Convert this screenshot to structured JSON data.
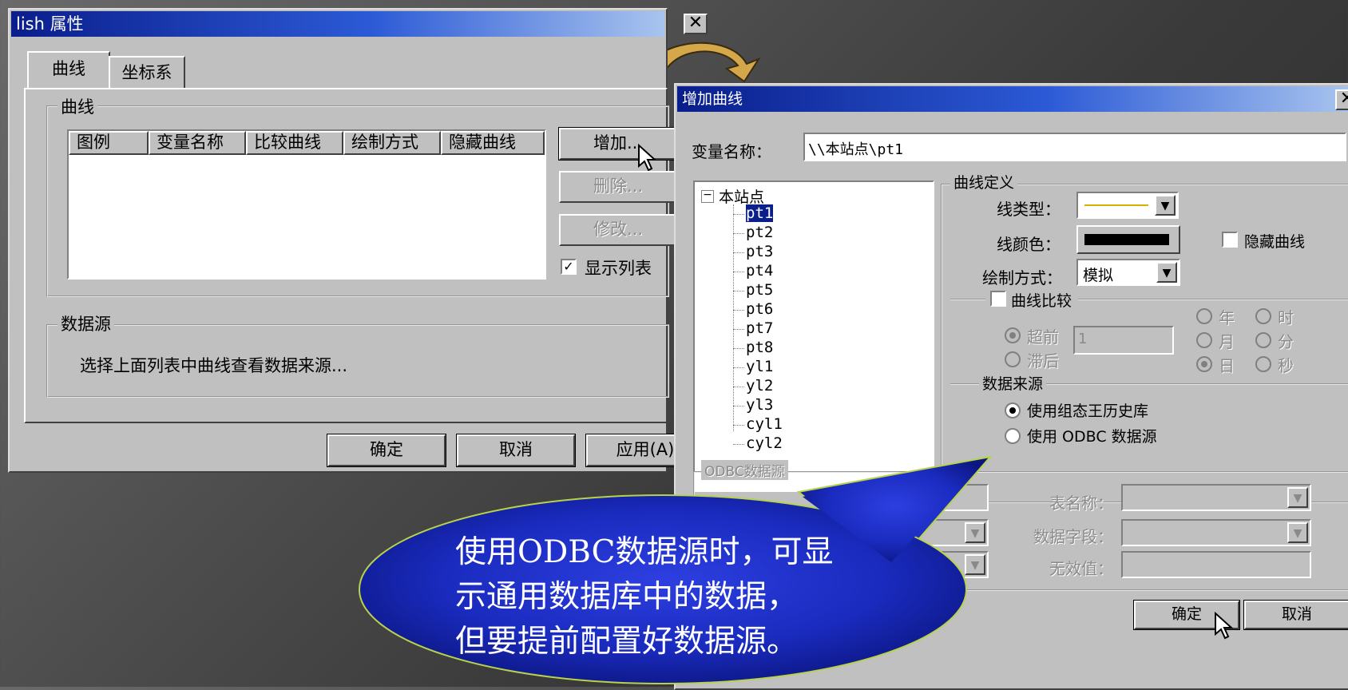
{
  "props_window": {
    "title": "lish 属性",
    "tabs": [
      "曲线",
      "坐标系"
    ],
    "curve_group_label": "曲线",
    "columns": [
      "图例",
      "变量名称",
      "比较曲线",
      "绘制方式",
      "隐藏曲线"
    ],
    "buttons": {
      "add": "增加...",
      "delete": "删除...",
      "modify": "修改..."
    },
    "show_list_label": "显示列表",
    "datasource_label": "数据源",
    "datasource_text": "选择上面列表中曲线查看数据来源...",
    "ok": "确定",
    "cancel": "取消",
    "apply": "应用(A)"
  },
  "add_window": {
    "title": "增加曲线",
    "var_label": "变量名称：",
    "var_value": "\\\\本站点\\pt1",
    "tree_root": "本站点",
    "tree_items": [
      "pt1",
      "pt2",
      "pt3",
      "pt4",
      "pt5",
      "pt6",
      "pt7",
      "pt8",
      "yl1",
      "yl2",
      "yl3",
      "cyl1",
      "cyl2"
    ],
    "curve_def_label": "曲线定义",
    "line_type_label": "线类型：",
    "line_color_label": "线颜色：",
    "hide_curve_label": "隐藏曲线",
    "draw_mode_label": "绘制方式：",
    "draw_mode_value": "模拟",
    "compare_label": "曲线比较",
    "ahead_label": "超前",
    "lag_label": "滞后",
    "offset_value": "1",
    "units": [
      "年",
      "时",
      "月",
      "分",
      "日",
      "秒"
    ],
    "source_label": "数据来源",
    "source_history": "使用组态王历史库",
    "source_odbc": "使用 ODBC 数据源",
    "odbc_group_label": "ODBC数据源",
    "table_name_label": "表名称：",
    "data_field_label": "数据字段：",
    "invalid_label": "无效值：",
    "ok": "确定",
    "cancel": "取消"
  },
  "callout_text": [
    "使用ODBC数据源时，可显",
    "示通用数据库中的数据，",
    "但要提前配置好数据源。"
  ],
  "colors": {
    "title_start": "#0a1e8c",
    "callout": "#1a2bbf",
    "arrow": "#d4a84a"
  }
}
